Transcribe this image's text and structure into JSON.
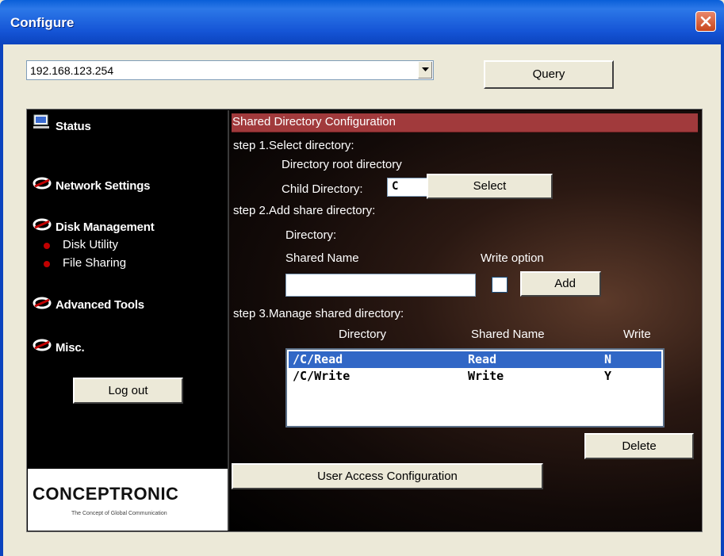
{
  "window": {
    "title": "Configure",
    "close_icon": "close-icon"
  },
  "top": {
    "ip_value": "192.168.123.254",
    "query_label": "Query"
  },
  "sidebar": {
    "items": [
      {
        "label": "Status",
        "icon": "monitor-icon"
      },
      {
        "label": "Network Settings",
        "icon": "logo-swirl-icon"
      },
      {
        "label": "Disk Management",
        "icon": "logo-swirl-icon"
      },
      {
        "label": "Advanced Tools",
        "icon": "logo-swirl-icon"
      },
      {
        "label": "Misc.",
        "icon": "logo-swirl-icon"
      }
    ],
    "sub_items": [
      {
        "label": "Disk Utility"
      },
      {
        "label": "File Sharing"
      }
    ],
    "logout_label": "Log out",
    "logo_text": "CONCEPTRONIC",
    "logo_tagline": "The Concept of Global Communication"
  },
  "content": {
    "section_title": "Shared Directory Configuration",
    "step1": "step 1.Select directory:",
    "directory_root": "Directory root directory",
    "child_directory_label": "Child Directory:",
    "child_directory_value": "C",
    "select_label": "Select",
    "step2": "step 2.Add share directory:",
    "directory_label": "Directory:",
    "shared_name_label": "Shared Name",
    "write_option_label": "Write option",
    "shared_name_value": "",
    "add_label": "Add",
    "step3": "step 3.Manage shared directory:",
    "col_directory": "Directory",
    "col_shared_name": "Shared Name",
    "col_write": "Write",
    "rows": [
      {
        "directory": "/C/Read",
        "shared_name": "Read",
        "write": "N",
        "selected": true
      },
      {
        "directory": "/C/Write",
        "shared_name": "Write",
        "write": "Y",
        "selected": false
      }
    ],
    "delete_label": "Delete",
    "user_access_label": "User Access Configuration"
  },
  "colors": {
    "title_blue": "#0A5FD8",
    "section_red": "#A13A3C",
    "selection_blue": "#3167C6",
    "bullet_red": "#C00000"
  }
}
